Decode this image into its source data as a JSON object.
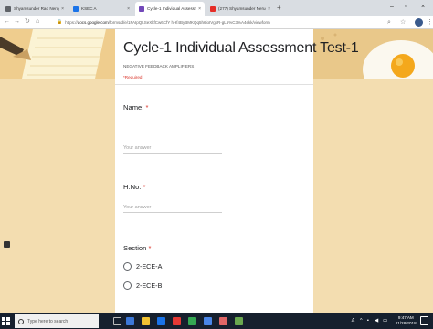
{
  "browser": {
    "tabs": [
      {
        "label": "Shyamsunder Rao Nerugu",
        "active": false,
        "favicon_color": "#5f6368"
      },
      {
        "label": "KSEC A",
        "active": false,
        "favicon_color": "#1a73e8"
      },
      {
        "label": "Cycle-1 Individual Assessment T",
        "active": true,
        "favicon_color": "#7248b9"
      },
      {
        "label": "(277) Shyamsunder Nerugu - Yo",
        "active": false,
        "favicon_color": "#e52d27"
      }
    ],
    "new_tab": "+",
    "window_controls": {
      "minimize": "–",
      "maximize": "▫",
      "close": "×"
    },
    "url_host": "docs.google.com",
    "url_prefix": "https://",
    "url_path": "/forms/d/e/1FAIpQLSeXkfCw6CfY hHf4ByBMKQq5h6ioIVgxR-gL5%C3%A4ekk/viewform"
  },
  "form": {
    "title": "Cycle-1 Individual Assessment Test-1",
    "description": "NEGATIVE FEEDBACK AMPLIFIERS",
    "required_note": "*Required",
    "questions": [
      {
        "label": "Name:",
        "required_mark": "*",
        "placeholder": "Your answer"
      },
      {
        "label": "H.No:",
        "required_mark": "*",
        "placeholder": "Your answer"
      },
      {
        "label": "Section",
        "required_mark": "*",
        "options": [
          "2-ECE-A",
          "2-ECE-B"
        ]
      }
    ]
  },
  "taskbar": {
    "search_placeholder": "Type here to search",
    "time": "9:47 AM",
    "date": "11/28/2018",
    "app_colors": [
      "#3c78d8",
      "#f1c232",
      "#1a73e8",
      "#e53935",
      "#34a853",
      "#4a86e8",
      "#e06666",
      "#6aa84f"
    ]
  },
  "colors": {
    "background": "#f3ddb0",
    "required": "#d93025",
    "taskbar": "#16202e"
  }
}
